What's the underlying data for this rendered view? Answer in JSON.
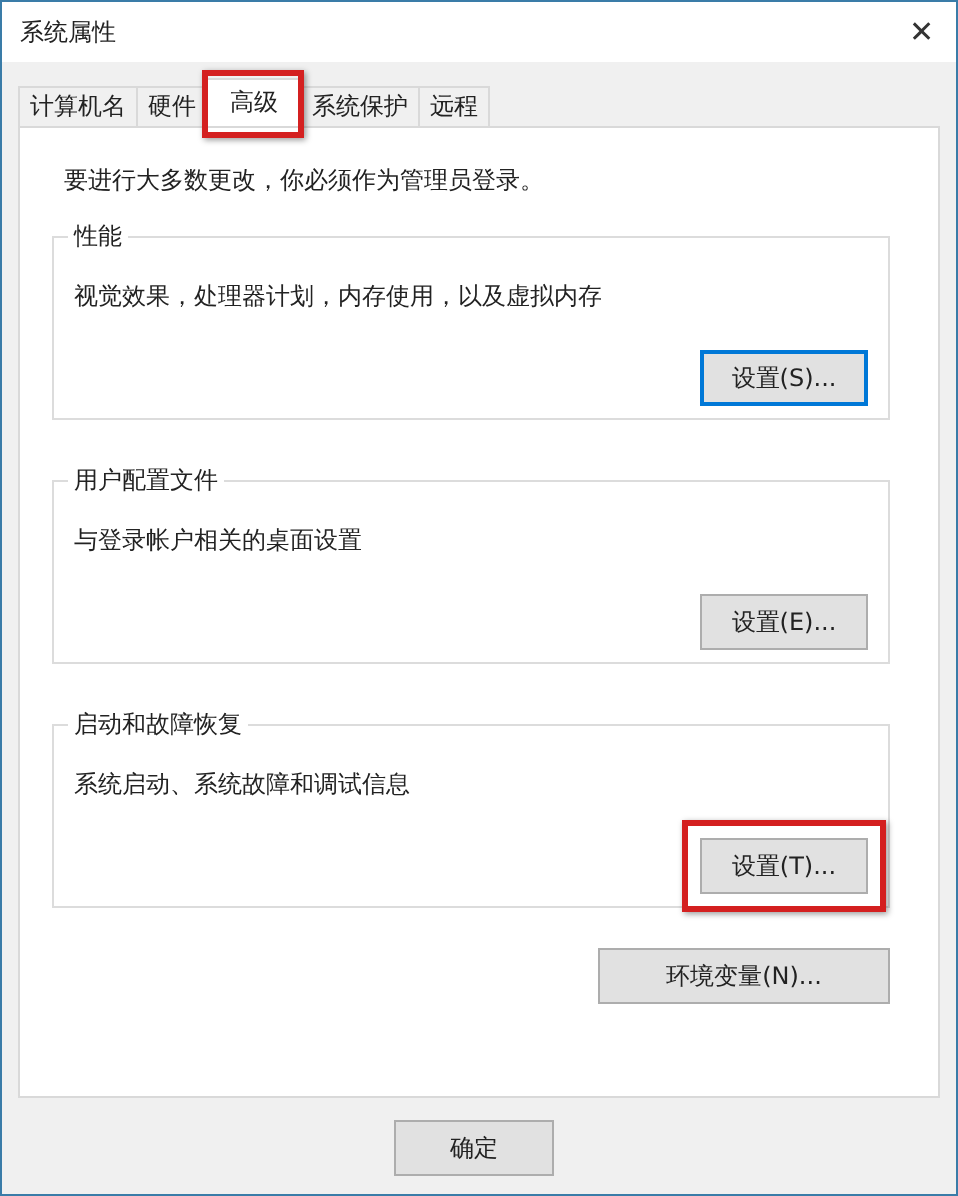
{
  "window": {
    "title": "系统属性",
    "close": "✕"
  },
  "tabs": [
    {
      "label": "计算机名",
      "selected": false,
      "highlighted": false
    },
    {
      "label": "硬件",
      "selected": false,
      "highlighted": false
    },
    {
      "label": "高级",
      "selected": true,
      "highlighted": true
    },
    {
      "label": "系统保护",
      "selected": false,
      "highlighted": false
    },
    {
      "label": "远程",
      "selected": false,
      "highlighted": false
    }
  ],
  "notice": "要进行大多数更改，你必须作为管理员登录。",
  "groups": [
    {
      "title": "性能",
      "description": "视觉效果，处理器计划，内存使用，以及虚拟内存",
      "button": {
        "label": "设置(S)...",
        "default": true,
        "highlighted": false
      }
    },
    {
      "title": "用户配置文件",
      "description": "与登录帐户相关的桌面设置",
      "button": {
        "label": "设置(E)...",
        "default": false,
        "highlighted": false
      }
    },
    {
      "title": "启动和故障恢复",
      "description": "系统启动、系统故障和调试信息",
      "button": {
        "label": "设置(T)...",
        "default": false,
        "highlighted": true
      }
    }
  ],
  "env_button": {
    "label": "环境变量(N)..."
  },
  "dialog_buttons": [
    {
      "label": "确定"
    }
  ]
}
